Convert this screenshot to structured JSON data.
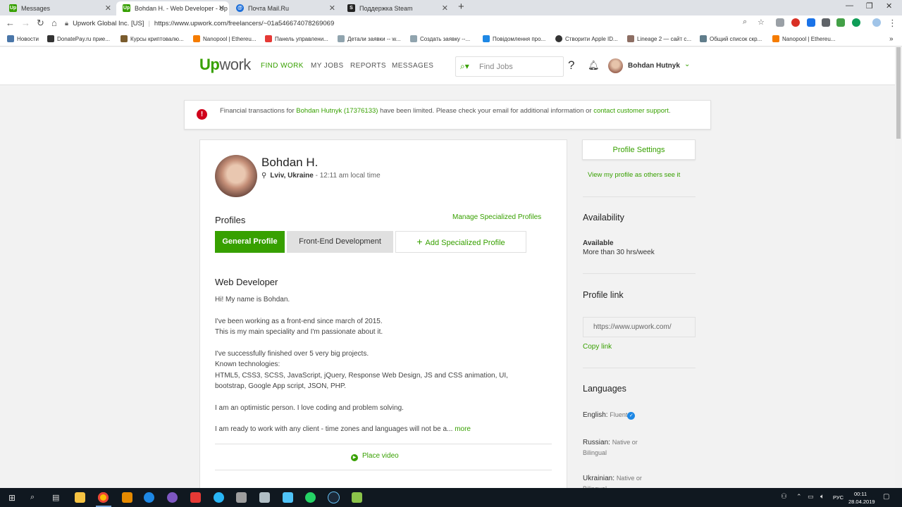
{
  "browser": {
    "tabs": [
      {
        "title": "Messages",
        "favicon": "upwork-icon",
        "active": false
      },
      {
        "title": "Bohdan H. - Web Developer - Up",
        "favicon": "upwork-icon",
        "active": true
      },
      {
        "title": "Почта Mail.Ru",
        "favicon": "mailru-icon",
        "active": false
      },
      {
        "title": "Поддержка Steam",
        "favicon": "steam-icon",
        "active": false
      }
    ],
    "address": {
      "site_name": "Upwork Global Inc. [US]",
      "url": "https://www.upwork.com/freelancers/~01a546674078269069"
    },
    "bookmarks": [
      "Новости",
      "DonatePay.ru прие...",
      "Курсы криптовалю...",
      "Nanopool | Ethereu...",
      "Панель управлени...",
      "Детали заявки -- w...",
      "Создать заявку --...",
      "Повідомлення про...",
      "Створити Apple ID...",
      "Lineage 2 — сайт с...",
      "Общий список скр...",
      "Nanopool | Ethereu..."
    ]
  },
  "header": {
    "logo_up": "Up",
    "logo_work": "work",
    "nav": [
      "FIND WORK",
      "MY JOBS",
      "REPORTS",
      "MESSAGES"
    ],
    "search_placeholder": "Find Jobs",
    "help": "?",
    "user_name": "Bohdan Hutnyk"
  },
  "alert": {
    "text_before": "Financial transactions for ",
    "account": "Bohdan Hutnyk (17376133)",
    "text_after": " have been limited. Please check your email for additional information or ",
    "link": "contact customer support",
    "end": "."
  },
  "profile": {
    "name": "Bohdan H.",
    "location": "Lviv, Ukraine",
    "local_time": " - 12:11 am local time",
    "profiles_heading": "Profiles",
    "manage_link": "Manage Specialized Profiles",
    "tabs": [
      "General Profile",
      "Front-End Development",
      "Add Specialized Profile"
    ],
    "title": "Web Developer",
    "overview": [
      "Hi! My name is Bohdan.",
      "",
      "I've been working as a front-end since march of 2015.",
      "This is my main speciality and I'm passionate about it.",
      "",
      "I've successfully finished over 5 very big projects.",
      "Known technologies:",
      "HTML5, CSS3, SCSS, JavaScript, jQuery, Response Web Design, JS and CSS animation, UI,",
      "bootstrap, Google App script, JSON, PHP.",
      "",
      "I am an optimistic person. I love coding and problem solving.",
      "",
      "I am ready to work with any client - time zones and languages will not be a..."
    ],
    "more": "more",
    "place_video": "Place video"
  },
  "sidebar": {
    "settings_button": "Profile Settings",
    "view_link": "View my profile as others see it",
    "availability_heading": "Availability",
    "available": "Available",
    "hours": "More than 30 hrs/week",
    "profile_link_heading": "Profile link",
    "profile_link_value": "https://www.upwork.com/",
    "copy_link": "Copy link",
    "languages_heading": "Languages",
    "languages": [
      {
        "name": "English:",
        "level": "Fluent"
      },
      {
        "name": "Russian:",
        "level": "Native or Bilingual"
      },
      {
        "name": "Ukrainian:",
        "level": "Native or Bilingual"
      }
    ]
  },
  "taskbar": {
    "lang": "РУС",
    "time": "00:11",
    "date": "28.04.2019"
  },
  "colors": {
    "brand_green": "#37a000",
    "alert_red": "#d0021b"
  }
}
